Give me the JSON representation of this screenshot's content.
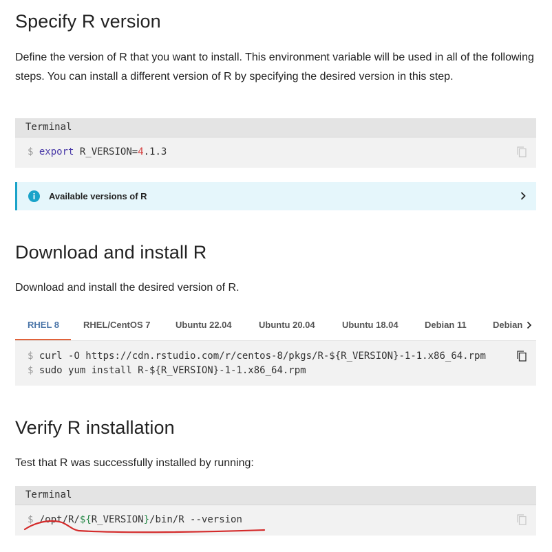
{
  "sections": {
    "specify": {
      "title": "Specify R version",
      "description": "Define the version of R that you want to install. This environment variable will be used in all of the following steps. You can install a different version of R by specifying the desired version in this step."
    },
    "download": {
      "title": "Download and install R",
      "description": "Download and install the desired version of R."
    },
    "verify": {
      "title": "Verify R installation",
      "description": "Test that R was successfully installed by running:"
    }
  },
  "terminal1": {
    "header": "Terminal",
    "prompt": "$",
    "keyword": "export",
    "var_prefix": "R_VERSION=",
    "version_major": "4",
    "version_rest": ".1.3"
  },
  "callout": {
    "label": "Available versions of R"
  },
  "tabs": [
    {
      "label": "RHEL 8",
      "active": true
    },
    {
      "label": "RHEL/CentOS 7",
      "active": false
    },
    {
      "label": "Ubuntu 22.04",
      "active": false
    },
    {
      "label": "Ubuntu 20.04",
      "active": false
    },
    {
      "label": "Ubuntu 18.04",
      "active": false
    },
    {
      "label": "Debian 11",
      "active": false
    },
    {
      "label": "Debian",
      "active": false
    }
  ],
  "download_code": {
    "prompt": "$",
    "line1": "curl -O https://cdn.rstudio.com/r/centos-8/pkgs/R-${R_VERSION}-1-1.x86_64.rpm",
    "line2": "sudo yum install R-${R_VERSION}-1-1.x86_64.rpm"
  },
  "terminal2": {
    "header": "Terminal",
    "prompt": "$",
    "path_prefix": "/opt/R/",
    "var_open": "${",
    "var_name": "R_VERSION",
    "var_close": "}",
    "path_suffix": "/bin/R --version"
  },
  "colors": {
    "accent_tab": "#4a75a8",
    "tab_underline": "#e0623a",
    "callout_border": "#1aa3c9",
    "callout_bg": "#e5f6fb",
    "annotation_stroke": "#d42a2a"
  },
  "icons": {
    "copy": "copy-icon",
    "info": "info-icon",
    "chevron": "chevron-right-icon"
  }
}
